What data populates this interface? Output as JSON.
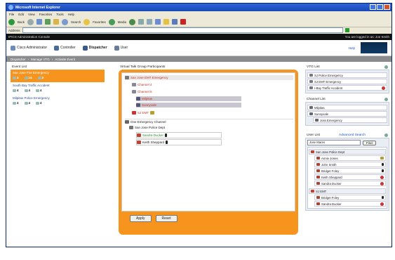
{
  "window": {
    "title": "Microsoft Internet Explorer"
  },
  "menu": [
    "File",
    "Edit",
    "View",
    "Favorites",
    "Tools",
    "Help"
  ],
  "toolbar": {
    "back": "Back",
    "search": "Search",
    "favorites": "Favorites",
    "media": "Media"
  },
  "address": {
    "label": "Address"
  },
  "console": {
    "title": "IPICS Administration Console",
    "user_note": "You are logged in as: Joe Smith"
  },
  "nav": {
    "items": [
      "Cisco Administrator",
      "Controller",
      "Dispatcher",
      "User"
    ],
    "help": "Help"
  },
  "breadcrumbs": [
    "Dispatcher",
    "Manage VTG",
    "Activate Event"
  ],
  "events": {
    "header": "Event List",
    "items": [
      {
        "name": "San Jose Fire Emergency",
        "c1": "4",
        "c2": "14",
        "c3": "3"
      },
      {
        "name": "South Bay Traffic Accident",
        "c1": "4",
        "c2": "4",
        "c3": "4"
      },
      {
        "name": "Milpitas Police Emergency",
        "c1": "4",
        "c2": "4",
        "c3": "4"
      }
    ]
  },
  "vtg": {
    "header": "Virtual Talk Group Participants",
    "group1": "San Jose EMT Emergency",
    "group1_items": [
      "Channel 4",
      "Channel 6",
      "Milpitas",
      "Sunnyvale"
    ],
    "group1_user": "SJ EMT",
    "group2": "San Jose Police Dept",
    "group2_parent": "One Emergency Channel",
    "group2_items": [
      "Sandra Ducker",
      "Keith Sheppard"
    ],
    "apply": "Apply",
    "reset": "Reset"
  },
  "vtg_list": {
    "header": "VTG List",
    "items": [
      "SJ Police Emergency",
      "SJ EMT Emergency",
      "I-Bay Traffic Accident"
    ]
  },
  "channel_list": {
    "header": "Channel List",
    "items": [
      "Milpitas",
      "Sunnyvale",
      "Joss Emergency"
    ]
  },
  "user_list": {
    "header": "User List",
    "advanced": "Advanced Search",
    "search_value": "Jose Mares",
    "find": "Find",
    "group1": "San Jose Police Dept",
    "group1_items": [
      "Annie Jones",
      "John Smith",
      "Bridget Foley",
      "Keith Sheppard",
      "Sandra Ducker"
    ],
    "group2": "SJ EMT",
    "group2_items": [
      "Bridget Foley",
      "Sandra Ducker"
    ]
  }
}
